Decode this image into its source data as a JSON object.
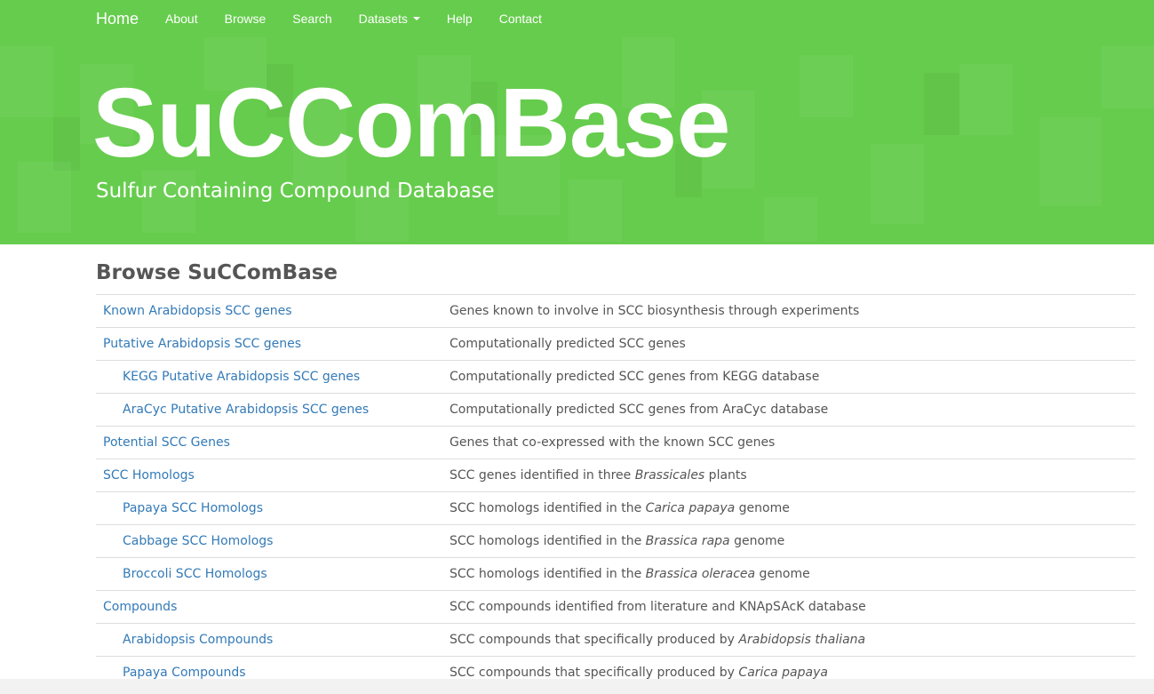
{
  "nav": {
    "brand": "Home",
    "items": [
      {
        "label": "About"
      },
      {
        "label": "Browse"
      },
      {
        "label": "Search"
      },
      {
        "label": "Datasets"
      },
      {
        "label": "Help"
      },
      {
        "label": "Contact"
      }
    ]
  },
  "hero": {
    "title": "SuCComBase",
    "subtitle": "Sulfur Containing Compound Database"
  },
  "browse": {
    "heading": "Browse SuCComBase",
    "rows": [
      {
        "name": "Known Arabidopsis SCC genes",
        "desc_pre": "Genes known to involve in SCC biosynthesis through experiments",
        "desc_em": "",
        "desc_post": ""
      },
      {
        "name": "Putative Arabidopsis SCC genes",
        "desc_pre": "Computationally predicted SCC genes",
        "desc_em": "",
        "desc_post": ""
      },
      {
        "name": "KEGG Putative Arabidopsis SCC genes",
        "desc_pre": "Computationally predicted SCC genes from KEGG database",
        "desc_em": "",
        "desc_post": ""
      },
      {
        "name": "AraCyc Putative Arabidopsis SCC genes",
        "desc_pre": "Computationally predicted SCC genes from AraCyc database",
        "desc_em": "",
        "desc_post": ""
      },
      {
        "name": "Potential SCC Genes",
        "desc_pre": "Genes that co-expressed with the known SCC genes",
        "desc_em": "",
        "desc_post": ""
      },
      {
        "name": "SCC Homologs",
        "desc_pre": "SCC genes identified in three ",
        "desc_em": "Brassicales",
        "desc_post": " plants"
      },
      {
        "name": "Papaya SCC Homologs",
        "desc_pre": "SCC homologs identified in the ",
        "desc_em": "Carica papaya",
        "desc_post": " genome"
      },
      {
        "name": "Cabbage SCC Homologs",
        "desc_pre": "SCC homologs identified in the ",
        "desc_em": "Brassica rapa",
        "desc_post": " genome"
      },
      {
        "name": "Broccoli SCC Homologs",
        "desc_pre": "SCC homologs identified in the ",
        "desc_em": "Brassica oleracea",
        "desc_post": " genome"
      },
      {
        "name": "Compounds",
        "desc_pre": "SCC compounds identified from literature and KNApSAcK database",
        "desc_em": "",
        "desc_post": ""
      },
      {
        "name": "Arabidopsis Compounds",
        "desc_pre": "SCC compounds that specifically produced by ",
        "desc_em": "Arabidopsis thaliana",
        "desc_post": ""
      },
      {
        "name": "Papaya Compounds",
        "desc_pre": "SCC compounds that specifically produced by ",
        "desc_em": "Carica papaya",
        "desc_post": ""
      }
    ]
  },
  "colors": {
    "brand_green": "#66cc4d",
    "link_blue": "#337ab7"
  }
}
